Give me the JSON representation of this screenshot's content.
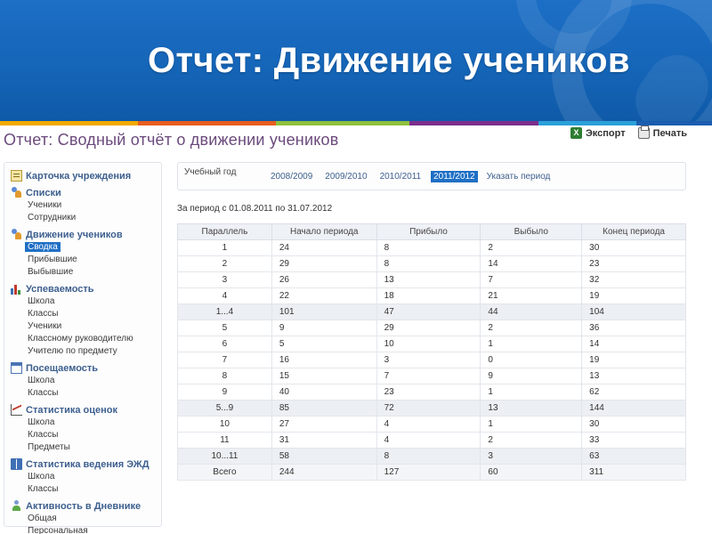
{
  "banner": {
    "title": "Отчет: Движение учеников"
  },
  "colors": {
    "banner_blue": "#1565b8",
    "stripe": [
      "#f2a900",
      "#e85d1f",
      "#8fbf3c",
      "#7b2e8b",
      "#2aa0d8",
      "#1a5db0"
    ],
    "accent_link": "#3d5f8e",
    "selected_bg": "#1f6fc5"
  },
  "page": {
    "title": "Отчет: Сводный отчёт о движении учеников"
  },
  "toolbar": {
    "export_label": "Экспорт",
    "print_label": "Печать"
  },
  "sidebar": {
    "sections": [
      {
        "icon": "card-icon",
        "label": "Карточка учреждения",
        "items": []
      },
      {
        "icon": "users-icon",
        "label": "Списки",
        "items": [
          "Ученики",
          "Сотрудники"
        ]
      },
      {
        "icon": "users-icon",
        "label": "Движение учеников",
        "items": [
          "Сводка",
          "Прибывшие",
          "Выбывшие"
        ],
        "active_item": "Сводка"
      },
      {
        "icon": "bar-chart-icon",
        "label": "Успеваемость",
        "items": [
          "Школа",
          "Классы",
          "Ученики",
          "Классному руководителю",
          "Учителю по предмету"
        ]
      },
      {
        "icon": "calendar-icon",
        "label": "Посещаемость",
        "items": [
          "Школа",
          "Классы"
        ]
      },
      {
        "icon": "line-chart-icon",
        "label": "Статистика оценок",
        "items": [
          "Школа",
          "Классы",
          "Предметы"
        ]
      },
      {
        "icon": "book-icon",
        "label": "Статистика ведения ЭЖД",
        "items": [
          "Школа",
          "Классы"
        ]
      },
      {
        "icon": "person-icon",
        "label": "Активность в Дневнике",
        "items": [
          "Общая",
          "Персональная"
        ]
      }
    ]
  },
  "year_bar": {
    "label": "Учебный год",
    "years": [
      "2008/2009",
      "2009/2010",
      "2010/2011",
      "2011/2012"
    ],
    "active_year": "2011/2012",
    "pick_label": "Указать период"
  },
  "period": "За период с 01.08.2011 по 31.07.2012",
  "table": {
    "headers": [
      "Параллель",
      "Начало периода",
      "Прибыло",
      "Выбыло",
      "Конец периода"
    ],
    "rows": [
      [
        "1",
        "24",
        "8",
        "2",
        "30"
      ],
      [
        "2",
        "29",
        "8",
        "14",
        "23"
      ],
      [
        "3",
        "26",
        "13",
        "7",
        "32"
      ],
      [
        "4",
        "22",
        "18",
        "21",
        "19"
      ],
      [
        "1...4",
        "101",
        "47",
        "44",
        "104"
      ],
      [
        "5",
        "9",
        "29",
        "2",
        "36"
      ],
      [
        "6",
        "5",
        "10",
        "1",
        "14"
      ],
      [
        "7",
        "16",
        "3",
        "0",
        "19"
      ],
      [
        "8",
        "15",
        "7",
        "9",
        "13"
      ],
      [
        "9",
        "40",
        "23",
        "1",
        "62"
      ],
      [
        "5...9",
        "85",
        "72",
        "13",
        "144"
      ],
      [
        "10",
        "27",
        "4",
        "1",
        "30"
      ],
      [
        "11",
        "31",
        "4",
        "2",
        "33"
      ],
      [
        "10...11",
        "58",
        "8",
        "3",
        "63"
      ],
      [
        "Всего",
        "244",
        "127",
        "60",
        "311"
      ]
    ]
  }
}
